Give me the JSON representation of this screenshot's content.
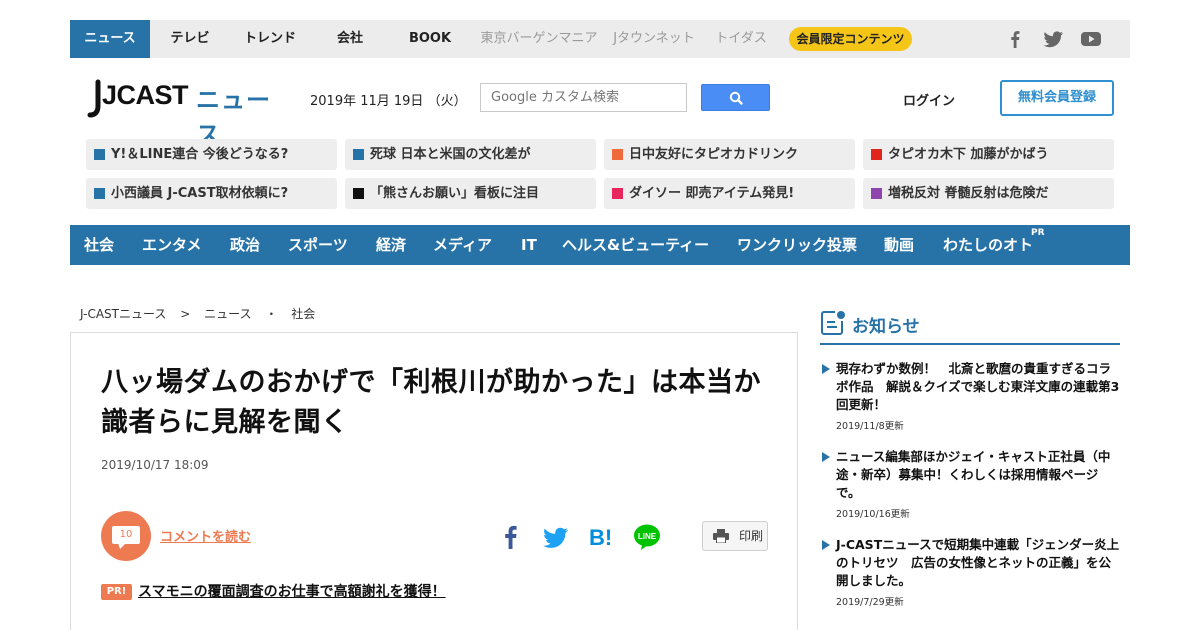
{
  "top_nav": {
    "items": [
      {
        "label": "ニュース"
      },
      {
        "label": "テレビ"
      },
      {
        "label": "トレンド"
      },
      {
        "label": "会社"
      },
      {
        "label": "BOOK"
      },
      {
        "label": "東京バーゲンマニア"
      },
      {
        "label": "Jタウンネット"
      },
      {
        "label": "トイダス"
      }
    ],
    "member_pill": "会員限定コンテンツ",
    "social_icons": [
      "facebook-icon",
      "twitter-icon",
      "youtube-icon"
    ]
  },
  "header": {
    "logo_main": "JCAST",
    "logo_sub": "ニュース",
    "date": "2019年 11月 19日 （火）",
    "search_placeholder": "Google カスタム検索",
    "login": "ログイン",
    "signup": "無料会員登録"
  },
  "trending": [
    {
      "label": "Y!＆LINE連合 今後どうなる?",
      "color": "#2773a8"
    },
    {
      "label": "死球 日本と米国の文化差が",
      "color": "#2773a8"
    },
    {
      "label": "日中友好にタピオカドリンク",
      "color": "#ef6a3a"
    },
    {
      "label": "タピオカ木下 加藤がかばう",
      "color": "#e0261c"
    },
    {
      "label": "小西議員 J-CAST取材依頼に?",
      "color": "#2773a8"
    },
    {
      "label": "「熊さんお願い」看板に注目",
      "color": "#111111"
    },
    {
      "label": "ダイソー 即売アイテム発見!",
      "color": "#e8265e"
    },
    {
      "label": "増税反対 脊髄反射は危険だ",
      "color": "#8e44ad"
    }
  ],
  "categories": [
    {
      "label": "社会"
    },
    {
      "label": "エンタメ"
    },
    {
      "label": "政治"
    },
    {
      "label": "スポーツ"
    },
    {
      "label": "経済"
    },
    {
      "label": "メディア"
    },
    {
      "label": "IT"
    },
    {
      "label": "ヘルス&ビューティー"
    },
    {
      "label": "ワンクリック投票"
    },
    {
      "label": "動画"
    },
    {
      "label": "わたしのオト"
    }
  ],
  "category_pr": "PR",
  "breadcrumb": [
    "J-CASTニュース",
    ">",
    "ニュース",
    "・",
    "社会"
  ],
  "article": {
    "title": "八ッ場ダムのおかげで「利根川が助かった」は本当か　識者らに見解を聞く",
    "date": "2019/10/17 18:09",
    "comment_count": "10",
    "comment_label": "コメントを読む",
    "print_label": "印刷",
    "share_icons": [
      "facebook-icon",
      "twitter-icon",
      "hatena-bookmark-icon",
      "line-icon"
    ],
    "pr_badge": "PR!",
    "pr_link": "スマモニの覆面調査のお仕事で高額謝礼を獲得！"
  },
  "sidebar": {
    "title": "お知らせ",
    "items": [
      {
        "text": "現存わずか数例！　北斎と歌麿の貴重すぎるコラボ作品　解説＆クイズで楽しむ東洋文庫の連載第3回更新！",
        "date": "2019/11/8更新"
      },
      {
        "text": "ニュース編集部ほかジェイ・キャスト正社員（中途・新卒）募集中！くわしくは採用情報ページで。",
        "date": "2019/10/16更新"
      },
      {
        "text": "J-CASTニュースで短期集中連載「ジェンダー炎上のトリセツ　広告の女性像とネットの正義」を公開しました。",
        "date": "2019/7/29更新"
      }
    ]
  },
  "colors": {
    "brand_blue": "#2773a8",
    "accent_orange": "#ee7a52",
    "member_yellow": "#f5c518",
    "search_blue": "#4a8ef5"
  }
}
